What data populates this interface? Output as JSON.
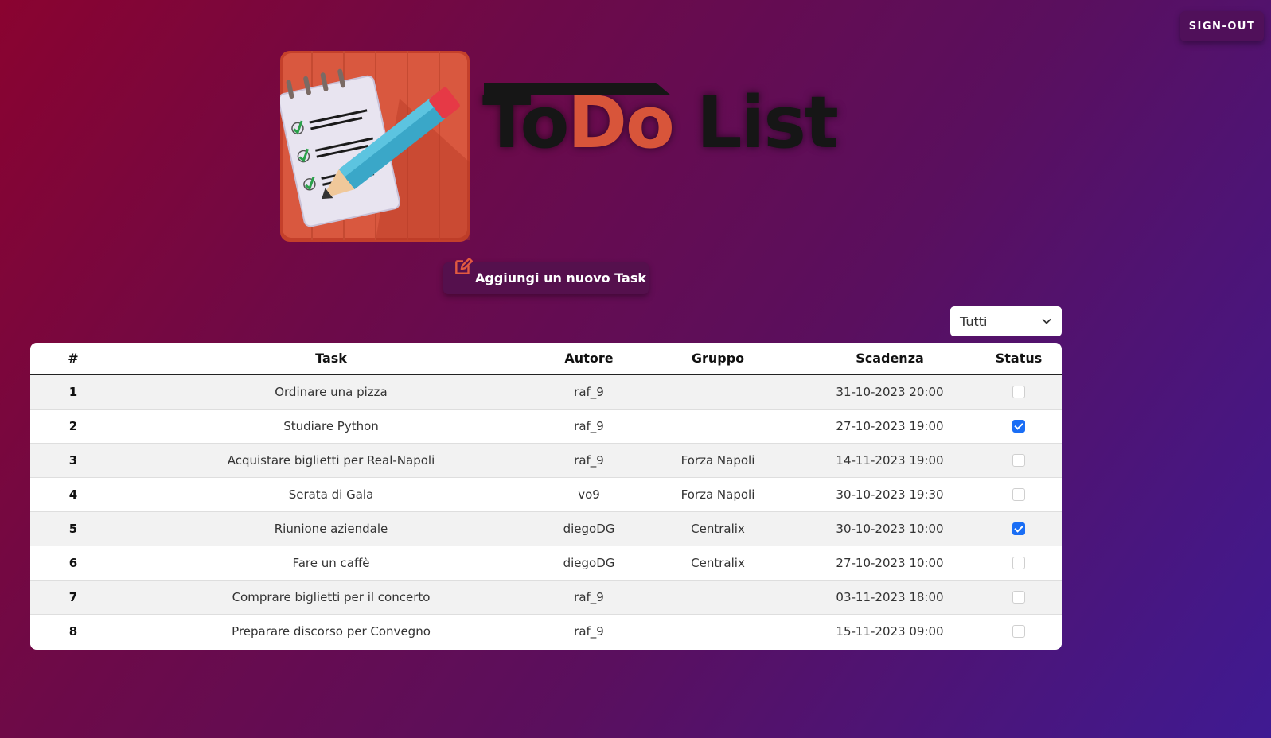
{
  "header": {
    "signout_label": "SIGN-OUT",
    "title_part1": "To",
    "title_part2": "Do",
    "title_part3": " List"
  },
  "logo": {
    "icon": "notepad-pencil-icon"
  },
  "add_task": {
    "label": "Aggiungi un nuovo Task",
    "icon": "edit-icon"
  },
  "filter": {
    "selected": "Tutti",
    "icon": "chevron-down-icon"
  },
  "table": {
    "columns": [
      "#",
      "Task",
      "Autore",
      "Gruppo",
      "Scadenza",
      "Status"
    ],
    "rows": [
      {
        "num": "1",
        "task": "Ordinare una pizza",
        "autore": "raf_9",
        "gruppo": "",
        "scadenza": "31-10-2023 20:00",
        "status": false
      },
      {
        "num": "2",
        "task": "Studiare Python",
        "autore": "raf_9",
        "gruppo": "",
        "scadenza": "27-10-2023 19:00",
        "status": true
      },
      {
        "num": "3",
        "task": "Acquistare biglietti per Real-Napoli",
        "autore": "raf_9",
        "gruppo": "Forza Napoli",
        "scadenza": "14-11-2023 19:00",
        "status": false
      },
      {
        "num": "4",
        "task": "Serata di Gala",
        "autore": "vo9",
        "gruppo": "Forza Napoli",
        "scadenza": "30-10-2023 19:30",
        "status": false
      },
      {
        "num": "5",
        "task": "Riunione aziendale",
        "autore": "diegoDG",
        "gruppo": "Centralix",
        "scadenza": "30-10-2023 10:00",
        "status": true
      },
      {
        "num": "6",
        "task": "Fare un caffè",
        "autore": "diegoDG",
        "gruppo": "Centralix",
        "scadenza": "27-10-2023 10:00",
        "status": false
      },
      {
        "num": "7",
        "task": "Comprare biglietti per il concerto",
        "autore": "raf_9",
        "gruppo": "",
        "scadenza": "03-11-2023 18:00",
        "status": false
      },
      {
        "num": "8",
        "task": "Preparare discorso per Convegno",
        "autore": "raf_9",
        "gruppo": "",
        "scadenza": "15-11-2023 09:00",
        "status": false
      }
    ]
  },
  "colors": {
    "accent_red": "#d8553a",
    "checkbox_blue": "#1a6ef5",
    "bg_start": "#8a0330",
    "bg_end": "#3f1a92"
  }
}
